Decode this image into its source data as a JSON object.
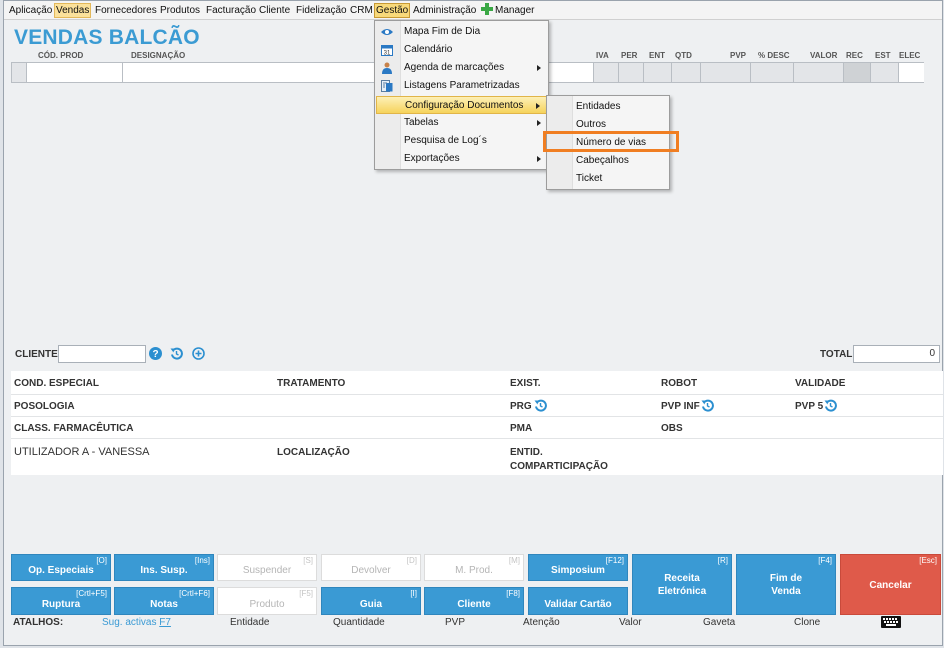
{
  "menubar": {
    "items": [
      "Aplicação",
      "Vendas",
      "Fornecedores",
      "Produtos",
      "Facturação",
      "Cliente",
      "Fidelização",
      "CRM",
      "Gestão",
      "Administração",
      "Manager"
    ]
  },
  "title": "VENDAS BALCÃO",
  "grid": {
    "headers": [
      "CÓD. PROD",
      "DESIGNAÇÃO",
      "IVA",
      "PER",
      "ENT",
      "QTD",
      "PVP",
      "% DESC",
      "VALOR",
      "REC",
      "EST",
      "ELEC"
    ]
  },
  "customer": {
    "cliente_label": "CLIENTE",
    "cliente_value": "",
    "total_label": "TOTAL",
    "total_value": "0"
  },
  "info": {
    "cond_especial": "COND. ESPECIAL",
    "tratamento": "TRATAMENTO",
    "exist": "EXIST.",
    "robot": "ROBOT",
    "validade": "VALIDADE",
    "posologia": "POSOLOGIA",
    "prg": "PRG",
    "pvp_inf": "PVP INF",
    "pvp5": "PVP 5",
    "class_farm": "CLASS. FARMACÊUTICA",
    "pma": "PMA",
    "obs": "OBS",
    "utilizador_label": "UTILIZADOR A",
    "utilizador_value": " - VANESSA",
    "localizacao": "LOCALIZAÇÃO",
    "entid_line1": "ENTID.",
    "entid_line2": "COMPARTICIPAÇÃO"
  },
  "buttons": {
    "op_especiais": {
      "label": "Op. Especiais",
      "key": "[O]"
    },
    "ins_susp": {
      "label": "Ins. Susp.",
      "key": "[Ins]"
    },
    "suspender": {
      "label": "Suspender",
      "key": "[S]"
    },
    "devolver": {
      "label": "Devolver",
      "key": "[D]"
    },
    "m_prod": {
      "label": "M. Prod.",
      "key": "[M]"
    },
    "simposium": {
      "label": "Simposium",
      "key": "[F12]"
    },
    "receita_l1": "Receita",
    "receita_l2": "Eletrónica",
    "receita_key": "[R]",
    "fim_l1": "Fim de",
    "fim_l2": "Venda",
    "fim_key": "[F4]",
    "cancelar": {
      "label": "Cancelar",
      "key": "[Esc]"
    },
    "ruptura": {
      "label": "Ruptura",
      "key": "[Crtl+F5]"
    },
    "notas": {
      "label": "Notas",
      "key": "[Crtl+F6]"
    },
    "produto": {
      "label": "Produto",
      "key": "[F5]"
    },
    "guia": {
      "label": "Guia",
      "key": "[I]"
    },
    "cliente": {
      "label": "Cliente",
      "key": "[F8]"
    },
    "validar": {
      "label": "Validar Cartão"
    }
  },
  "shortcuts": {
    "label": "ATALHOS:",
    "sug": "Sug. activas ",
    "sug_key": "F7",
    "entidade": "Entidade",
    "quantidade": "Quantidade",
    "pvp": "PVP",
    "atencao": "Atenção",
    "valor": "Valor",
    "gaveta": "Gaveta",
    "clone": "Clone"
  },
  "gestao_menu": {
    "items": [
      "Mapa Fim de Dia",
      "Calendário",
      "Agenda de marcações",
      "Listagens Parametrizadas",
      "Configuração Documentos",
      "Tabelas",
      "Pesquisa de Log´s",
      "Exportações"
    ]
  },
  "config_submenu": {
    "items": [
      "Entidades",
      "Outros",
      "Número de vias",
      "Cabeçalhos",
      "Ticket"
    ]
  },
  "colors": {
    "accent": "#3a9ad4",
    "cancel": "#df5a4a",
    "highlight": "#f07e22"
  }
}
